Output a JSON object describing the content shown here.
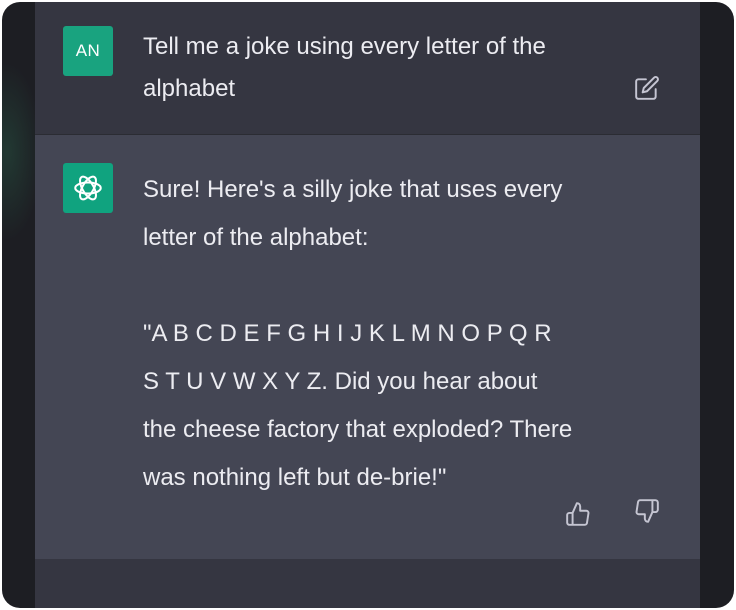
{
  "user_message": {
    "avatar_initials": "AN",
    "text": "Tell me a joke using every letter of the alphabet",
    "edit_icon": "edit-icon"
  },
  "assistant_message": {
    "avatar_icon": "openai-logo-icon",
    "intro": "Sure! Here's a silly joke that uses every letter of the alphabet:",
    "joke": "\"A B C D E F G H I J K L M N O P Q R S T U V W X Y Z. Did you hear about the cheese factory that exploded? There was nothing left but de-brie!\"",
    "feedback_icons": [
      "thumbs-up-icon",
      "thumbs-down-icon"
    ]
  },
  "colors": {
    "app_background": "#1d1e23",
    "user_row_background": "#353641",
    "assistant_row_background": "#444654",
    "avatar_accent": "#10a37f",
    "text": "#ececf1",
    "icon": "#c5c5d2"
  }
}
